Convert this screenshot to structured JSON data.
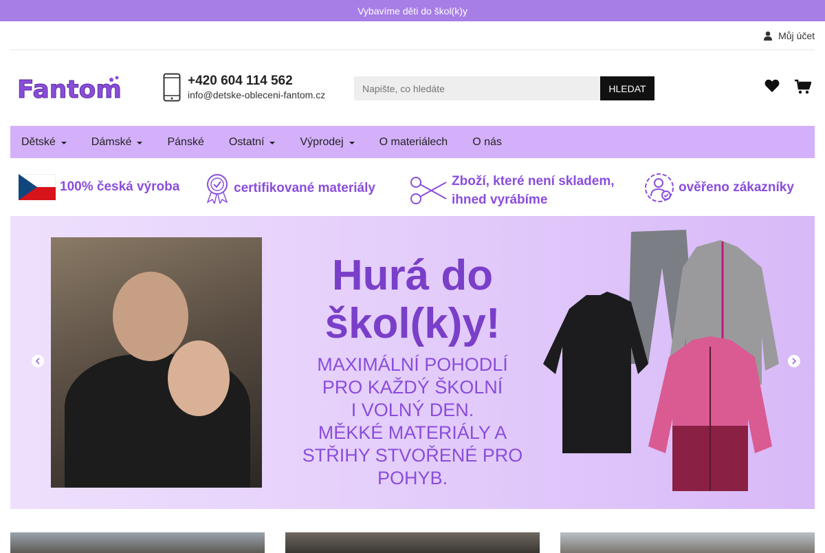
{
  "promo": {
    "text": "Vybavíme děti do škol(k)y"
  },
  "topbar": {
    "account_label": "Můj účet"
  },
  "header": {
    "logo_text": "Fantom",
    "phone": "+420 604 114 562",
    "email": "info@detske-obleceni-fantom.cz",
    "search_placeholder": "Napište, co hledáte",
    "search_button": "HLEDAT"
  },
  "nav": {
    "items": [
      {
        "label": "Dětské"
      },
      {
        "label": "Dámské"
      },
      {
        "label": "Pánské"
      },
      {
        "label": "Ostatní"
      },
      {
        "label": "Výprodej"
      },
      {
        "label": "O materiálech"
      },
      {
        "label": "O nás"
      }
    ]
  },
  "usp": [
    {
      "text": "100% česká výroba"
    },
    {
      "text": "certifikované materiály"
    },
    {
      "line1": "Zboží, které není skladem,",
      "line2": "ihned vyrábíme"
    },
    {
      "text": "ověřeno zákazníky"
    }
  ],
  "banner": {
    "title_line1": "Hurá do",
    "title_line2": "škol(k)y!",
    "sub_lines": [
      "MAXIMÁLNÍ POHODLÍ",
      "PRO KAŽDÝ ŠKOLNÍ",
      "I VOLNÝ DEN.",
      "MĚKKÉ MATERIÁLY A",
      "STŘIHY STVOŘENÉ PRO",
      "POHYB."
    ]
  },
  "colors": {
    "promo": "#a77de6",
    "nav": "#d4b0fb",
    "accent": "#8a4ddb",
    "title": "#7a3fc9"
  }
}
